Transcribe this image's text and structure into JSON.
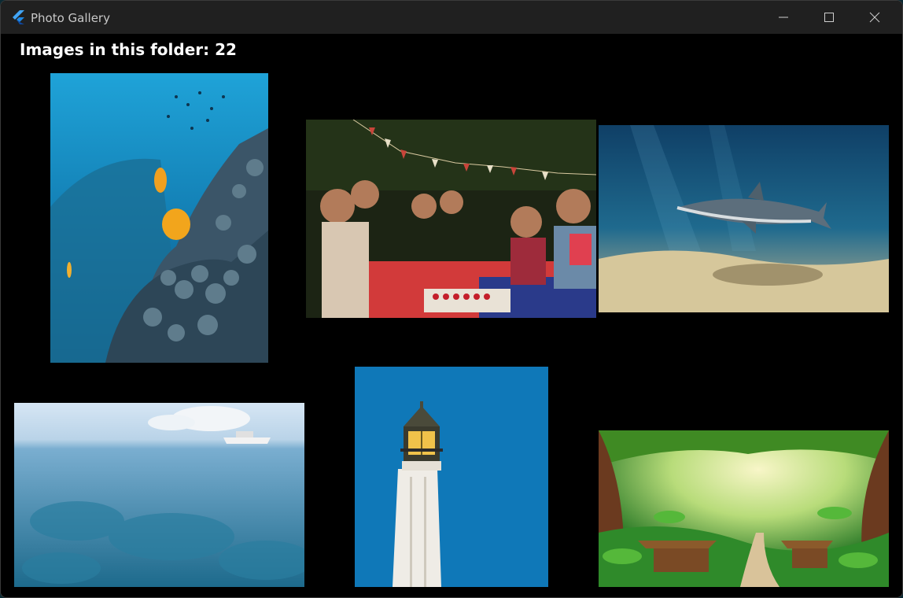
{
  "window": {
    "title": "Photo Gallery",
    "controls": {
      "minimize": "minimize-icon",
      "maximize": "maximize-icon",
      "close": "close-icon"
    }
  },
  "gallery": {
    "heading": "Images in this folder: 22",
    "photos": [
      {
        "subject": "coral-reef-fish"
      },
      {
        "subject": "july-4th-party"
      },
      {
        "subject": "shark-underwater"
      },
      {
        "subject": "clear-sea-boat"
      },
      {
        "subject": "lighthouse"
      },
      {
        "subject": "jungle-huts"
      }
    ]
  },
  "colors": {
    "accent": "#3fa9f5",
    "background": "#000000",
    "titlebar": "#202020"
  }
}
